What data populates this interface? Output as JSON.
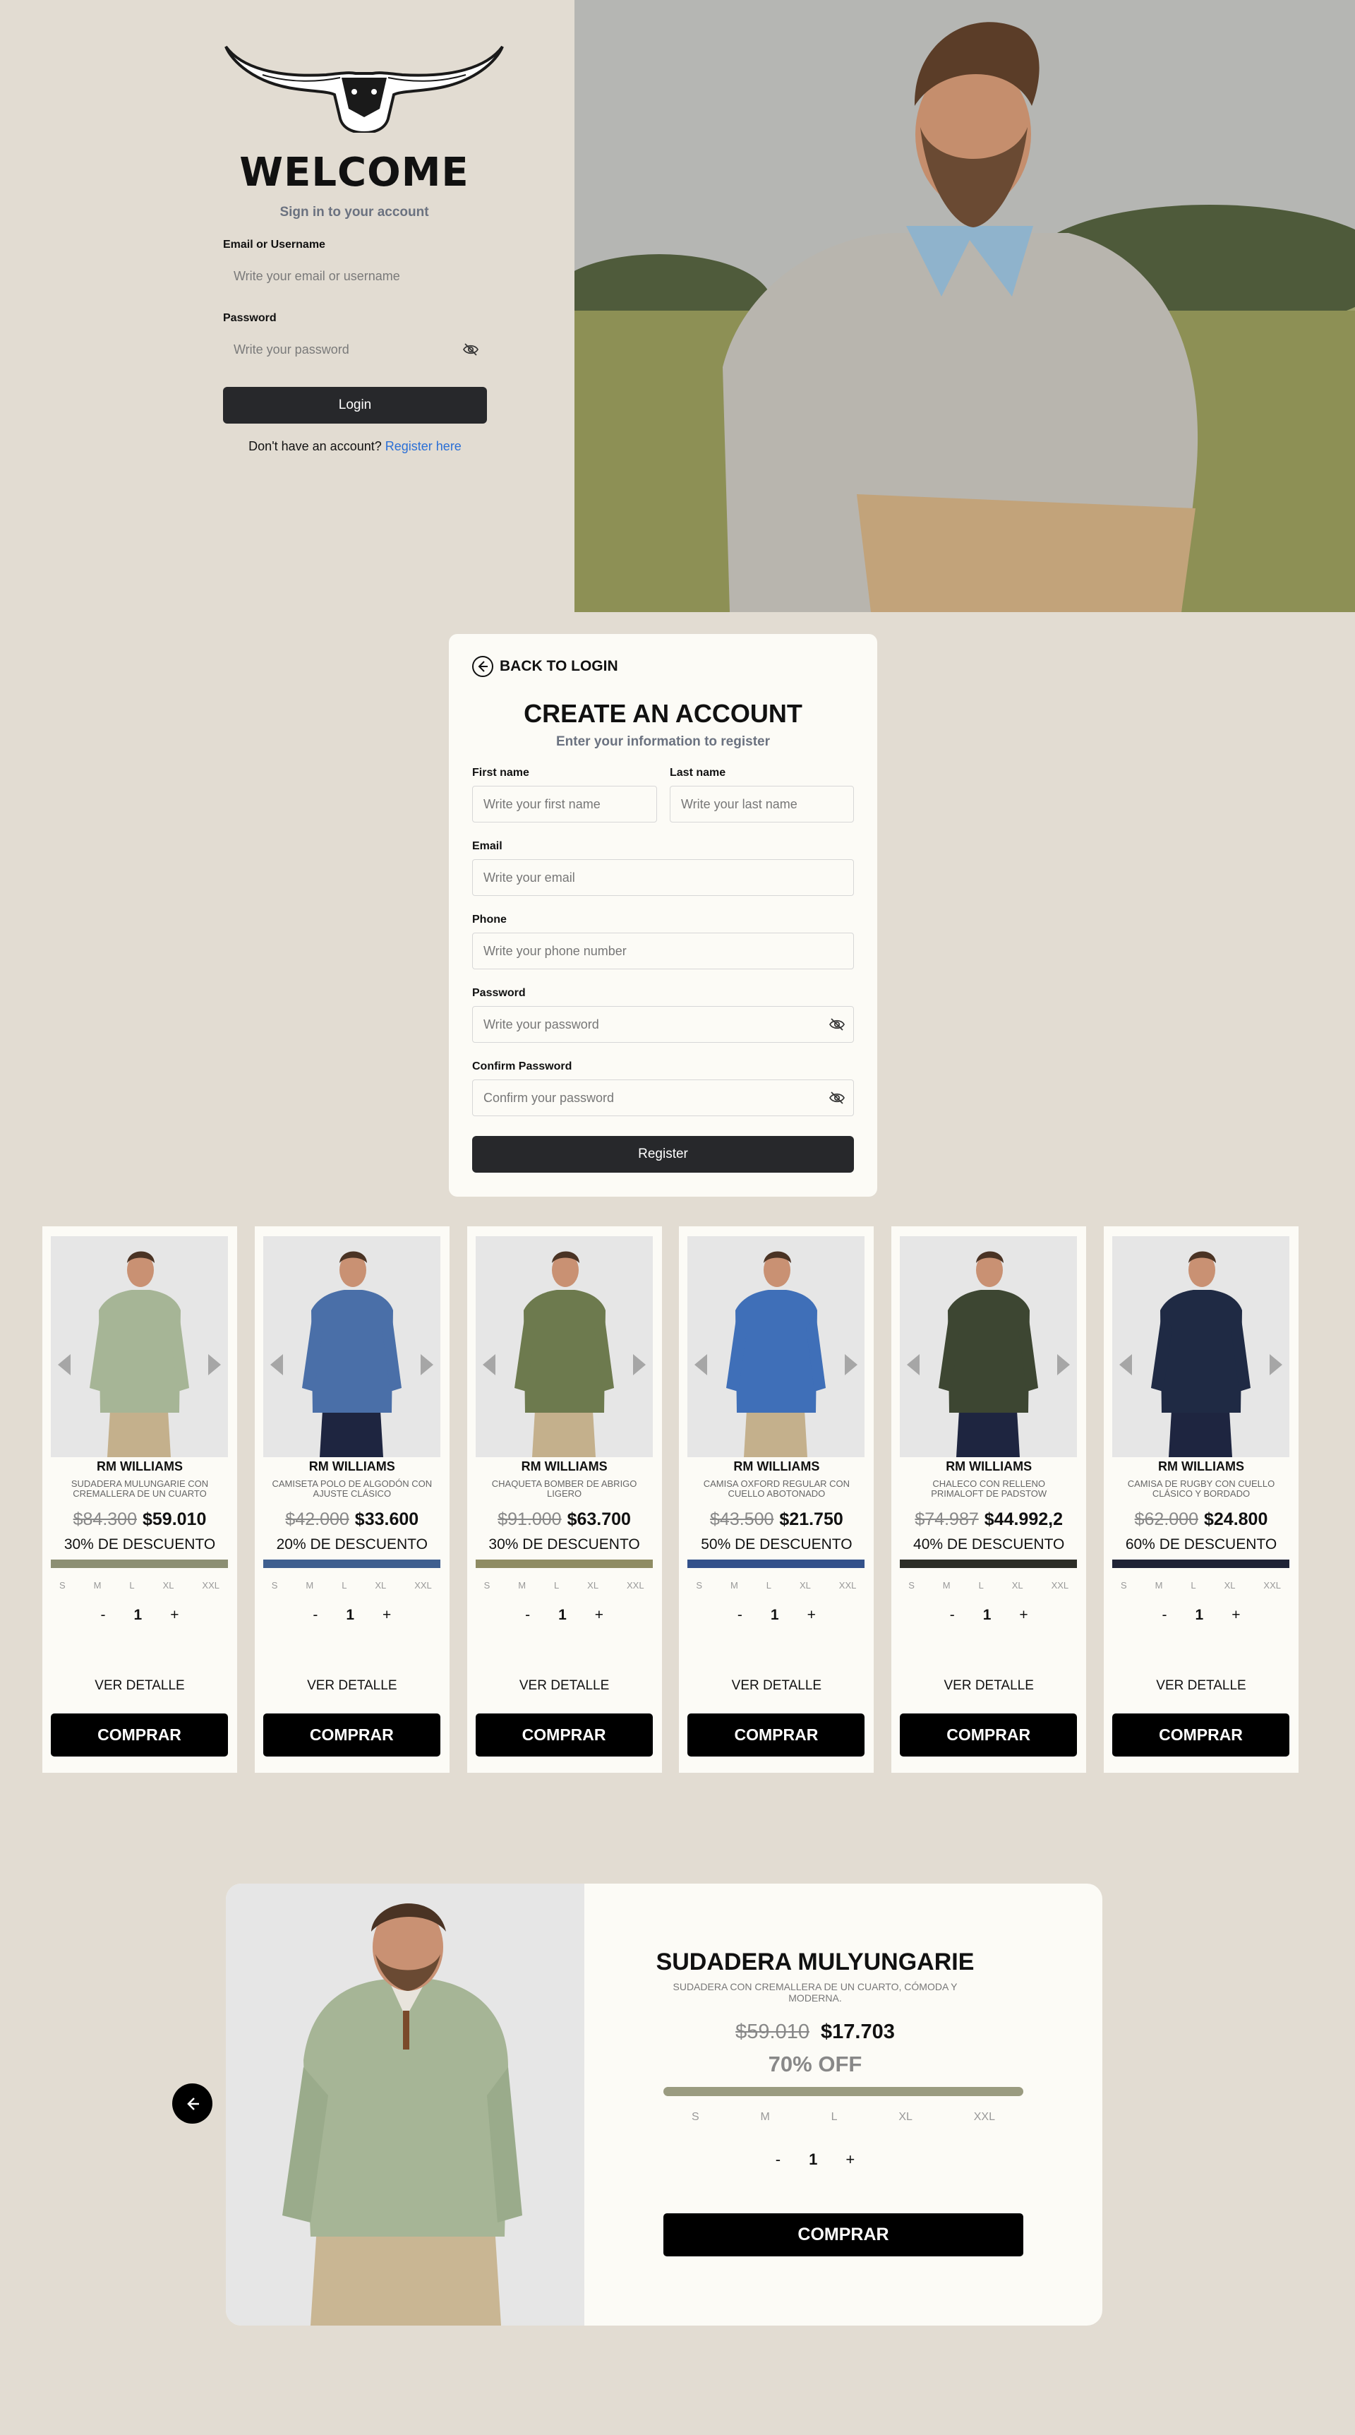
{
  "login": {
    "title": "WELCOME",
    "subtitle": "Sign in to your account",
    "email_label": "Email or Username",
    "email_placeholder": "Write your email or username",
    "password_label": "Password",
    "password_placeholder": "Write your password",
    "button": "Login",
    "no_account": "Don't have an account?",
    "register_link": "Register here"
  },
  "register": {
    "back": "BACK TO LOGIN",
    "title": "CREATE AN ACCOUNT",
    "subtitle": "Enter your information to register",
    "first_name_label": "First name",
    "first_name_placeholder": "Write your first name",
    "last_name_label": "Last name",
    "last_name_placeholder": "Write your last name",
    "email_label": "Email",
    "email_placeholder": "Write your email",
    "phone_label": "Phone",
    "phone_placeholder": "Write your phone number",
    "password_label": "Password",
    "password_placeholder": "Write your password",
    "confirm_label": "Confirm Password",
    "confirm_placeholder": "Confirm your password",
    "button": "Register"
  },
  "sizes": [
    "S",
    "M",
    "L",
    "XL",
    "XXL"
  ],
  "products": [
    {
      "brand": "RM WILLIAMS",
      "name": "SUDADERA MULUNGARIE CON CREMALLERA DE UN CUARTO",
      "old_price": "$84.300",
      "new_price": "$59.010",
      "discount": "30% DE DESCUENTO",
      "color": "#8c8f73",
      "qty": "1",
      "detail": "VER DETALLE",
      "buy": "COMPRAR"
    },
    {
      "brand": "RM WILLIAMS",
      "name": "CAMISETA POLO DE ALGODÓN CON AJUSTE CLÁSICO",
      "old_price": "$42.000",
      "new_price": "$33.600",
      "discount": "20% DE DESCUENTO",
      "color": "#3f5f8f",
      "qty": "1",
      "detail": "VER DETALLE",
      "buy": "COMPRAR"
    },
    {
      "brand": "RM WILLIAMS",
      "name": "CHAQUETA BOMBER DE ABRIGO LIGERO",
      "old_price": "$91.000",
      "new_price": "$63.700",
      "discount": "30% DE DESCUENTO",
      "color": "#8f8c63",
      "qty": "1",
      "detail": "VER DETALLE",
      "buy": "COMPRAR"
    },
    {
      "brand": "RM WILLIAMS",
      "name": "CAMISA OXFORD REGULAR CON CUELLO ABOTONADO",
      "old_price": "$43.500",
      "new_price": "$21.750",
      "discount": "50% DE DESCUENTO",
      "color": "#33518a",
      "qty": "1",
      "detail": "VER DETALLE",
      "buy": "COMPRAR"
    },
    {
      "brand": "RM WILLIAMS",
      "name": "CHALECO CON RELLENO PRIMALOFT DE PADSTOW",
      "old_price": "$74.987",
      "new_price": "$44.992,2",
      "discount": "40% DE DESCUENTO",
      "color": "#2d2e27",
      "qty": "1",
      "detail": "VER DETALLE",
      "buy": "COMPRAR"
    },
    {
      "brand": "RM WILLIAMS",
      "name": "CAMISA DE RUGBY CON CUELLO CLÁSICO Y BORDADO",
      "old_price": "$62.000",
      "new_price": "$24.800",
      "discount": "60% DE DESCUENTO",
      "color": "#1f2336",
      "qty": "1",
      "detail": "VER DETALLE",
      "buy": "COMPRAR"
    }
  ],
  "detail": {
    "title": "SUDADERA MULYUNGARIE",
    "subtitle": "SUDADERA CON CREMALLERA DE UN CUARTO, CÓMODA Y MODERNA.",
    "old_price": "$59.010",
    "new_price": "$17.703",
    "off": "70% OFF",
    "color": "#9a9b80",
    "qty": "1",
    "buy": "COMPRAR"
  },
  "qty_minus": "-",
  "qty_plus": "+"
}
